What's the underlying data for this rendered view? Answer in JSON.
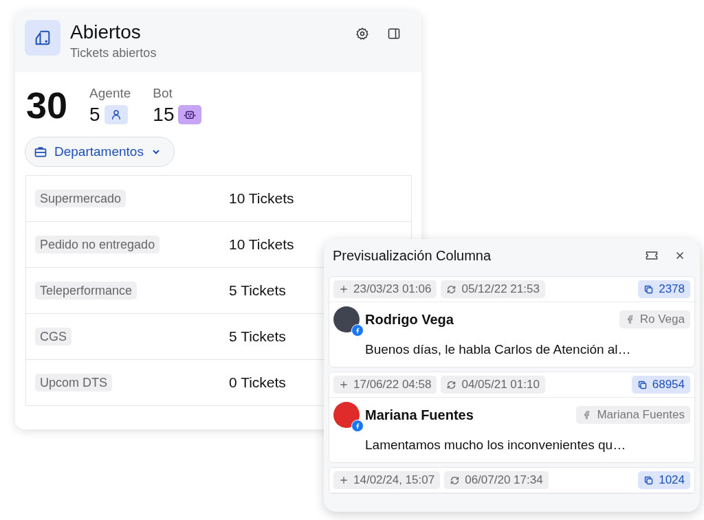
{
  "card": {
    "title": "Abiertos",
    "subtitle": "Tickets abiertos",
    "total": "30",
    "stats": [
      {
        "kind": "agent",
        "label": "Agente",
        "value": "5"
      },
      {
        "kind": "bot",
        "label": "Bot",
        "value": "15"
      }
    ],
    "dropdown": {
      "label": "Departamentos"
    },
    "departments": [
      {
        "name": "Supermercado",
        "count": "10 Tickets"
      },
      {
        "name": "Pedido no entregado",
        "count": "10 Tickets"
      },
      {
        "name": "Teleperformance",
        "count": "5 Tickets"
      },
      {
        "name": "CGS",
        "count": "5 Tickets"
      },
      {
        "name": "Upcom DTS",
        "count": "0 Tickets"
      }
    ]
  },
  "preview": {
    "title": "Previsualización Columna",
    "tickets": [
      {
        "created": "23/03/23 01:06",
        "updated": "05/12/22 21:53",
        "id": "2378",
        "name": "Rodrigo Vega",
        "kind": "facebook",
        "handle": "Ro Vega",
        "message": "Buenos días, le habla Carlos de Atención al…",
        "color": "#3f4450"
      },
      {
        "created": "17/06/22 04:58",
        "updated": "04/05/21 01:10",
        "id": "68954",
        "name": "Mariana Fuentes",
        "kind": "facebook",
        "handle": "Mariana Fuentes",
        "message": "Lamentamos mucho los inconvenientes qu…",
        "color": "#e02b2b"
      },
      {
        "created": "14/02/24, 15:07",
        "updated": "06/07/20 17:34",
        "id": "1024"
      }
    ]
  }
}
